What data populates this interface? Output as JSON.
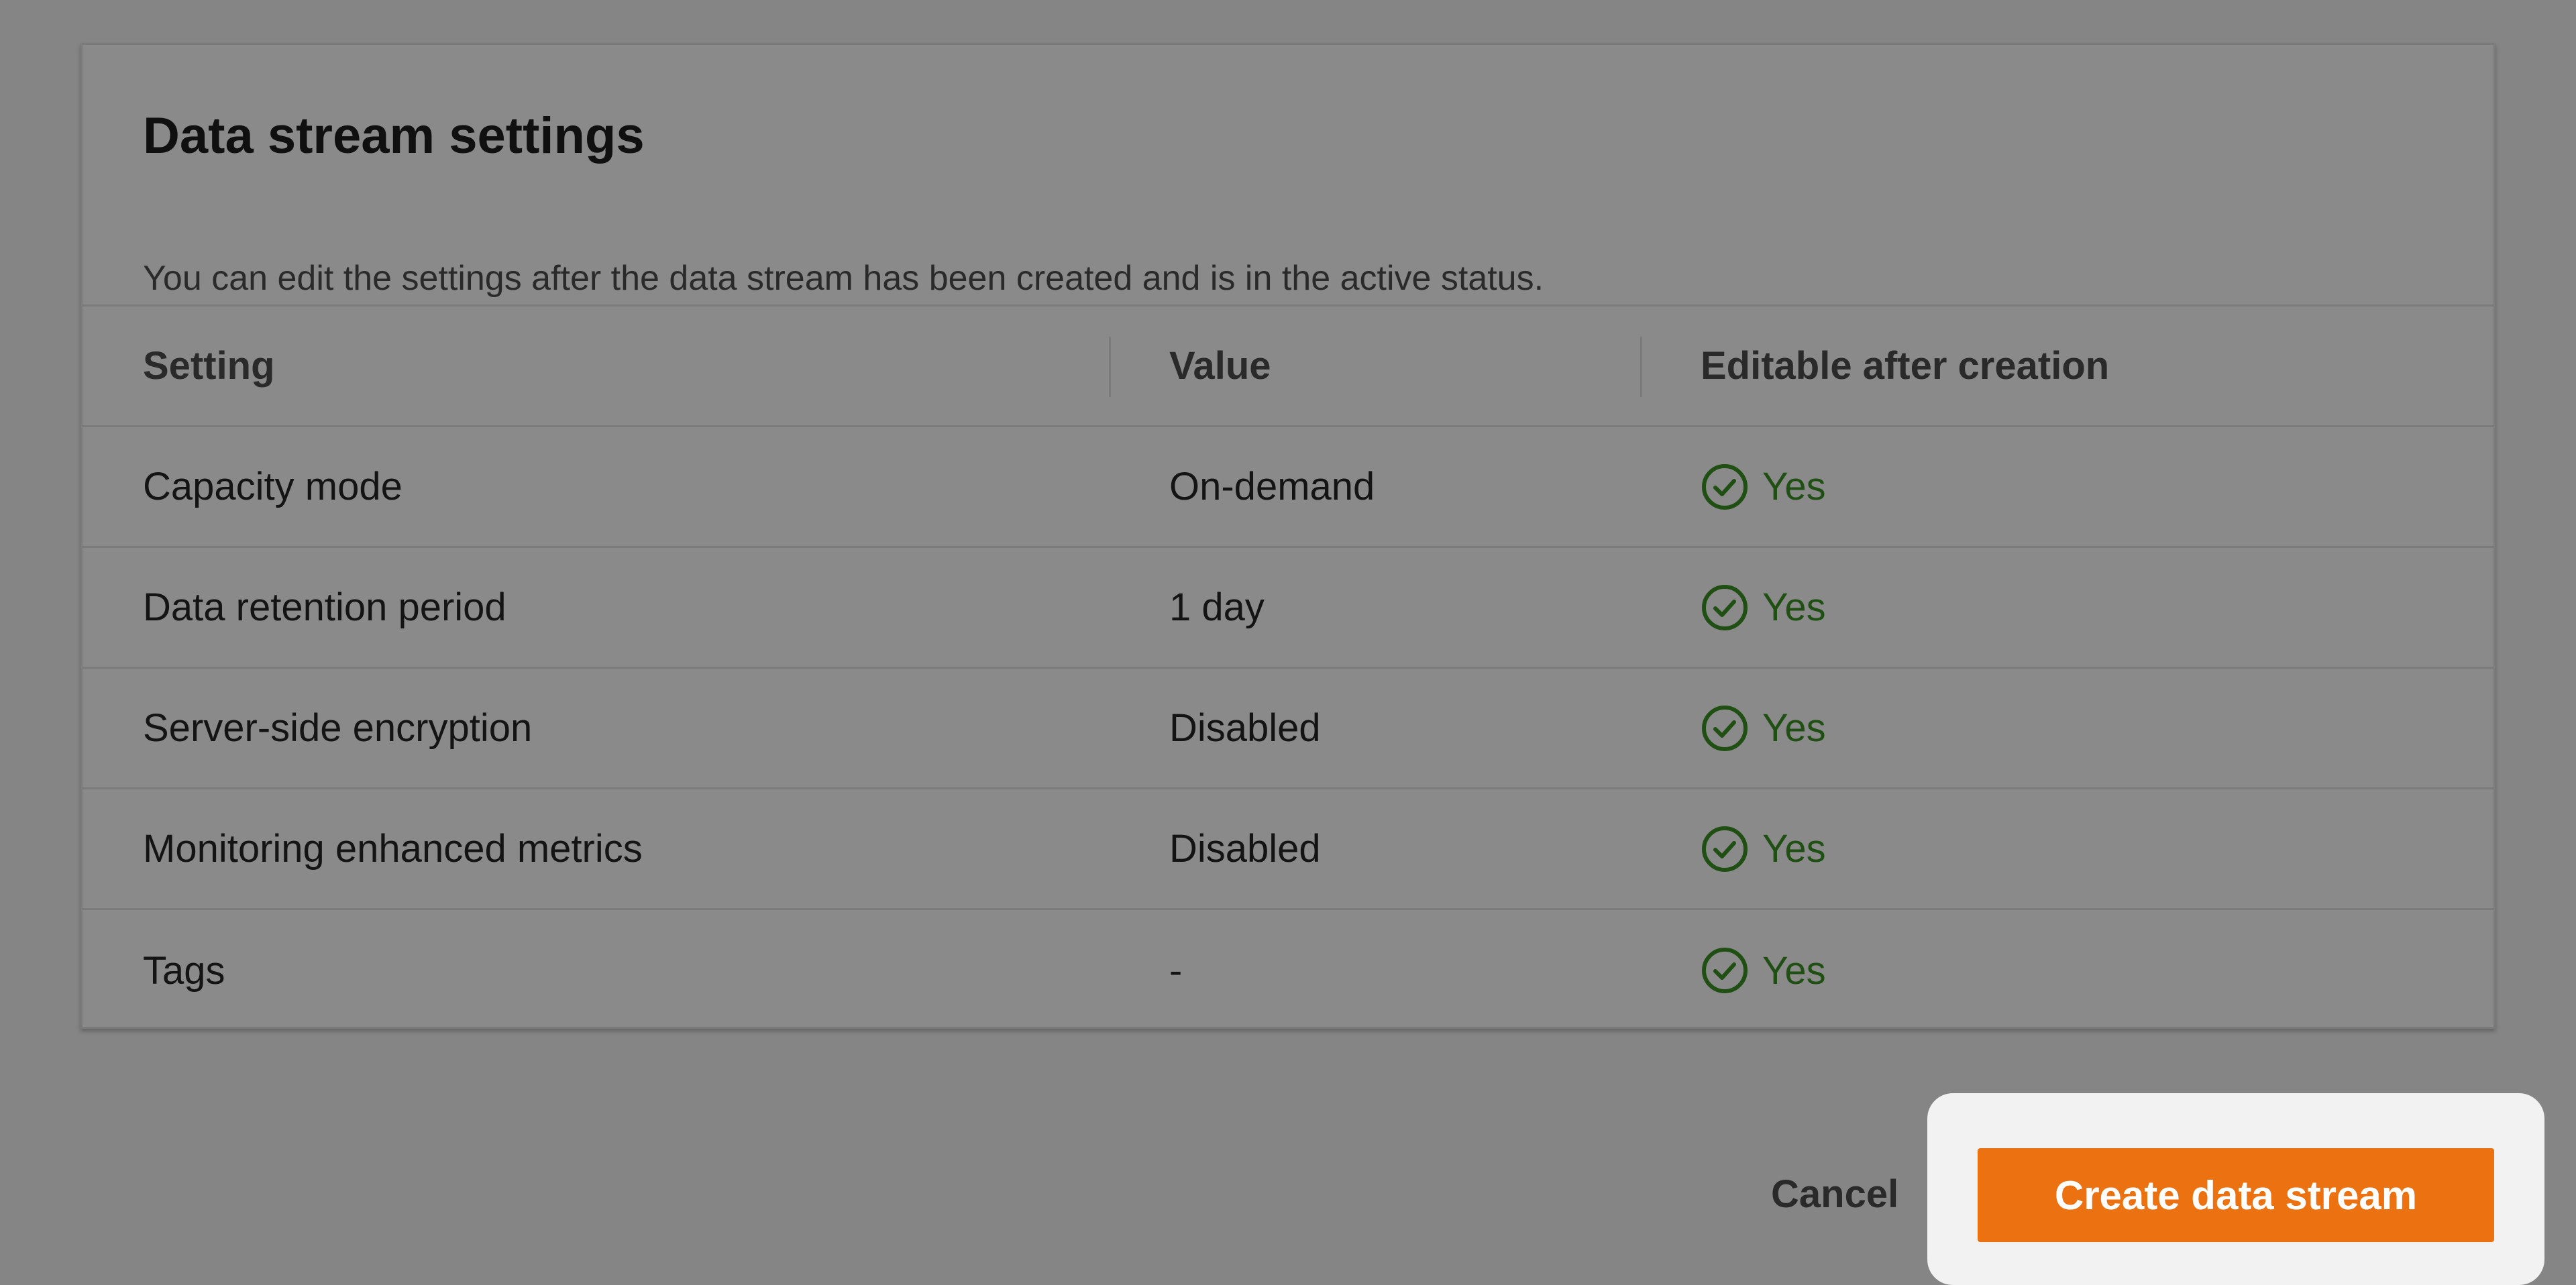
{
  "panel": {
    "title": "Data stream settings",
    "description": "You can edit the settings after the data stream has been created and is in the active status."
  },
  "table": {
    "columns": [
      "Setting",
      "Value",
      "Editable after creation"
    ],
    "rows": [
      {
        "setting": "Capacity mode",
        "value": "On-demand",
        "editable": "Yes",
        "icon": "check-circle-icon"
      },
      {
        "setting": "Data retention period",
        "value": "1 day",
        "editable": "Yes",
        "icon": "check-circle-icon"
      },
      {
        "setting": "Server-side encryption",
        "value": "Disabled",
        "editable": "Yes",
        "icon": "check-circle-icon"
      },
      {
        "setting": "Monitoring enhanced metrics",
        "value": "Disabled",
        "editable": "Yes",
        "icon": "check-circle-icon"
      },
      {
        "setting": "Tags",
        "value": "-",
        "editable": "Yes",
        "icon": "check-circle-icon"
      }
    ]
  },
  "actions": {
    "cancel_label": "Cancel",
    "create_label": "Create data stream"
  },
  "colors": {
    "overlay": "#858585",
    "success": "#1f4f12",
    "primary": "#ec7211",
    "highlight": "#f2f2f2"
  }
}
